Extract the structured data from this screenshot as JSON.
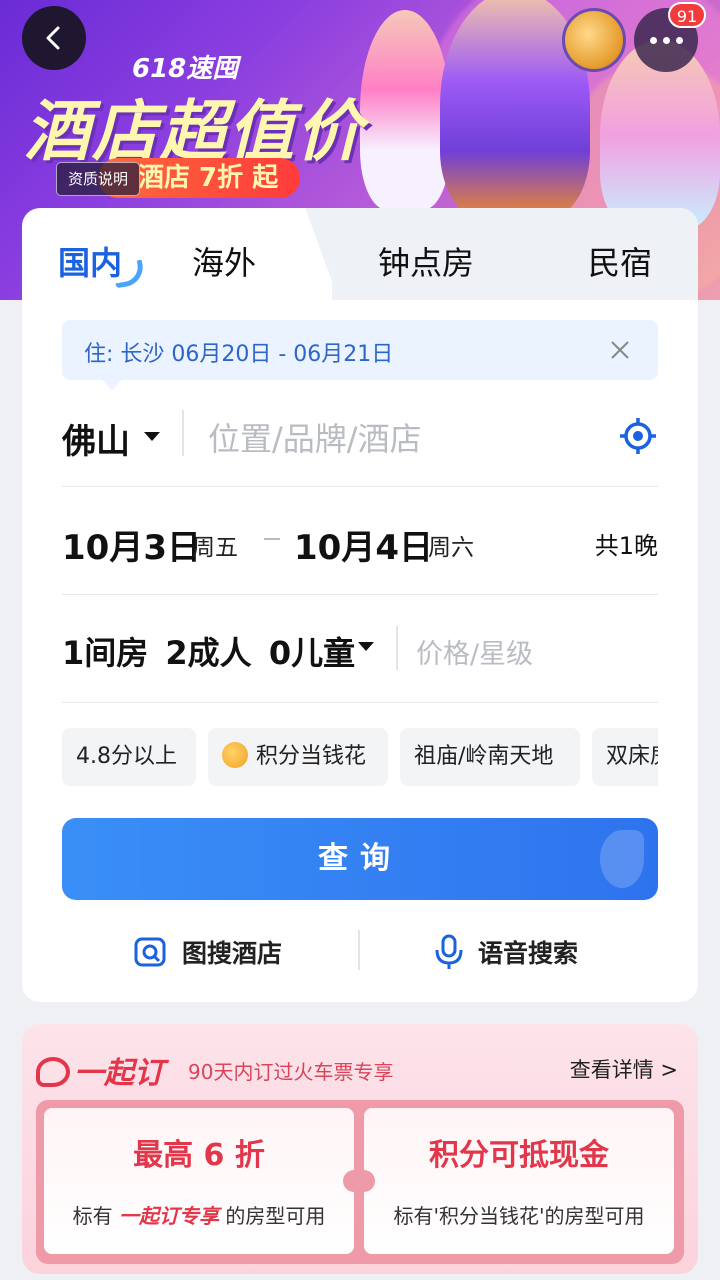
{
  "banner": {
    "event_tag": "618速囤",
    "title": "酒店超值价",
    "pill": "酒店 7折 起",
    "qualification_label": "资质说明",
    "notification_count": "91"
  },
  "tabs": [
    {
      "label": "国内",
      "active": true
    },
    {
      "label": "海外",
      "active": false
    },
    {
      "label": "钟点房",
      "active": false
    },
    {
      "label": "民宿",
      "active": false
    }
  ],
  "recent_search": {
    "text": "住: 长沙 06月20日 - 06月21日"
  },
  "search": {
    "city": "佛山",
    "placeholder": "位置/品牌/酒店"
  },
  "dates": {
    "checkin": "10月3日",
    "checkin_weekday": "周五",
    "checkout": "10月4日",
    "checkout_weekday": "周六",
    "nights": "共1晚"
  },
  "guests": {
    "summary": "1间房 2成人 0儿童",
    "price_placeholder": "价格/星级"
  },
  "chips": [
    {
      "label": "4.8分以上"
    },
    {
      "label": "积分当钱花"
    },
    {
      "label": "祖庙/岭南天地"
    },
    {
      "label": "双床房"
    }
  ],
  "query_button": "查询",
  "tools": {
    "image_search": "图搜酒店",
    "voice_search": "语音搜索"
  },
  "promo": {
    "logo": "一起订",
    "subtitle": "90天内订过火车票专享",
    "detail_link": "查看详情 >",
    "coupon1_title": "最高 6 折",
    "coupon1_pre": "标有",
    "coupon1_em": "一起订专享",
    "coupon1_post": "的房型可用",
    "coupon2_title": "积分可抵现金",
    "coupon2_desc": "标有'积分当钱花'的房型可用"
  },
  "colors": {
    "accent": "#1b62e0",
    "query_button": "#2e73ee",
    "promo_red": "#e2364a"
  }
}
